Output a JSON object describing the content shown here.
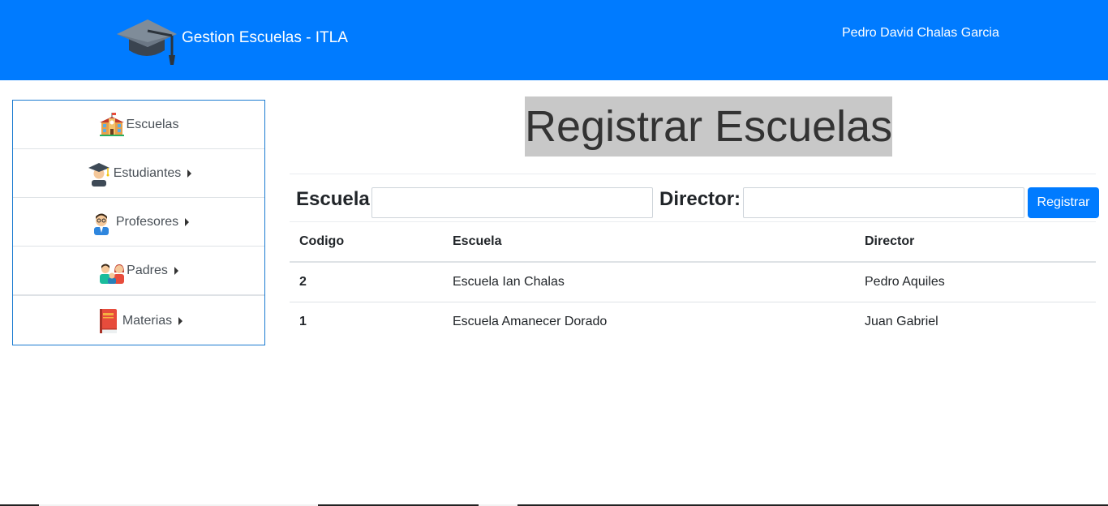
{
  "colors": {
    "primary": "#007bff",
    "sidebar_border": "#1b7bd1",
    "title_highlight": "#c8c8c8"
  },
  "navbar": {
    "brand": "Gestion Escuelas - ITLA",
    "brand_icon": "graduation-cap-icon",
    "user": "Pedro David Chalas Garcia"
  },
  "sidebar": {
    "items": [
      {
        "label": "Escuelas",
        "icon": "school-icon",
        "has_caret": false
      },
      {
        "label": "Estudiantes",
        "icon": "student-icon",
        "has_caret": true
      },
      {
        "label": "Profesores",
        "icon": "teacher-icon",
        "has_caret": true
      },
      {
        "label": "Padres",
        "icon": "parents-icon",
        "has_caret": true
      },
      {
        "label": "Materias",
        "icon": "book-icon",
        "has_caret": true
      }
    ]
  },
  "main": {
    "title": "Registrar Escuelas",
    "form": {
      "school_label": "Escuela:",
      "school_value": "",
      "director_label": "Director:",
      "director_value": "",
      "submit_label": "Registrar"
    },
    "table": {
      "headers": [
        "Codigo",
        "Escuela",
        "Director"
      ],
      "rows": [
        [
          "2",
          "Escuela Ian Chalas",
          "Pedro Aquiles"
        ],
        [
          "1",
          "Escuela Amanecer Dorado",
          "Juan Gabriel"
        ]
      ]
    }
  }
}
